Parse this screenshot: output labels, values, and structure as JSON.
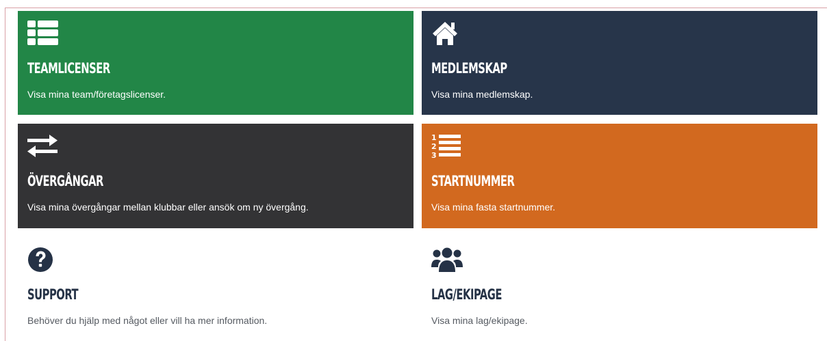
{
  "colors": {
    "green": "#228647",
    "navy": "#27354a",
    "charcoal": "#333335",
    "orange": "#d2691f",
    "white_text": "#ffffff",
    "dark_text": "#253246"
  },
  "tiles": [
    {
      "icon": "list-icon",
      "title": "TEAMLICENSER",
      "description": "Visa mina team/företagslicenser."
    },
    {
      "icon": "home-icon",
      "title": "MEDLEMSKAP",
      "description": "Visa mina medlemskap."
    },
    {
      "icon": "exchange-arrows-icon",
      "title": "ÖVERGÅNGAR",
      "description": "Visa mina övergångar mellan klubbar eller ansök om ny övergång."
    },
    {
      "icon": "numbered-list-icon",
      "title": "STARTNUMMER",
      "description": "Visa mina fasta startnummer."
    },
    {
      "icon": "question-circle-icon",
      "title": "SUPPORT",
      "description": "Behöver du hjälp med något eller vill ha mer information."
    },
    {
      "icon": "users-icon",
      "title": "LAG/EKIPAGE",
      "description": "Visa mina lag/ekipage."
    }
  ]
}
